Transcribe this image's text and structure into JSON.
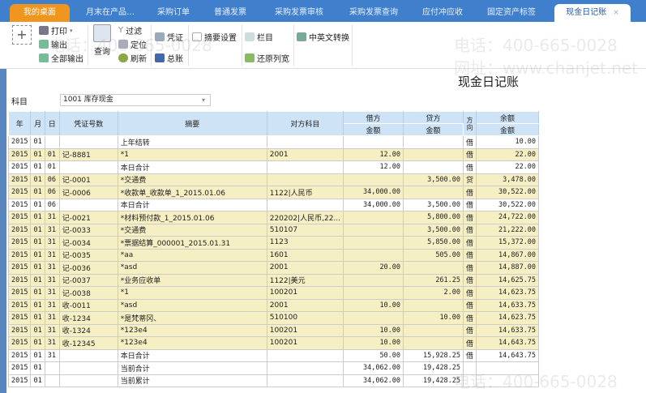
{
  "tabs": [
    {
      "label": "我的桌面"
    },
    {
      "label": "月末在产品…"
    },
    {
      "label": "采购订单"
    },
    {
      "label": "普通发票"
    },
    {
      "label": "采购发票审核"
    },
    {
      "label": "采购发票查询"
    },
    {
      "label": "应付冲应收"
    },
    {
      "label": "固定资产标签"
    },
    {
      "label": "现金日记账",
      "close": "×"
    }
  ],
  "toolbar": {
    "add": "+",
    "print": "打印",
    "output": "输出",
    "output_all": "全部输出",
    "query": "查询",
    "filter": "过滤",
    "locate": "定位",
    "refresh": "刷新",
    "voucher": "凭证",
    "ledger": "总账",
    "summary_setting": "摘要设置",
    "columns": "栏目",
    "restore_width": "还原列宽",
    "cn_en": "中英文转换"
  },
  "page": {
    "title": "现金日记账",
    "subject_label": "科目",
    "subject_value": "1001 库存现金"
  },
  "headers": {
    "year": "年",
    "month": "月",
    "day": "日",
    "voucher_no": "凭证号数",
    "summary": "摘要",
    "counter_account": "对方科目",
    "debit": "借方",
    "credit": "贷方",
    "amount": "金额",
    "direction": "方向",
    "balance": "余额"
  },
  "rows": [
    [
      "2015",
      "01",
      "",
      "",
      "上年结转",
      "",
      "",
      "",
      "借",
      "10.00",
      "w"
    ],
    [
      "2015",
      "01",
      "01",
      "记-8881",
      "*1",
      "2001",
      "12.00",
      "",
      "借",
      "22.00",
      "y"
    ],
    [
      "2015",
      "01",
      "01",
      "",
      "本日合计",
      "",
      "12.00",
      "",
      "借",
      "22.00",
      "w"
    ],
    [
      "2015",
      "01",
      "06",
      "记-0001",
      "*交通费",
      "",
      "",
      "3,500.00",
      "贷",
      "3,478.00",
      "y"
    ],
    [
      "2015",
      "01",
      "06",
      "记-0006",
      "*收款单_收款单_1_2015.01.06",
      "1122|人民币",
      "34,000.00",
      "",
      "借",
      "30,522.00",
      "y"
    ],
    [
      "2015",
      "01",
      "06",
      "",
      "本日合计",
      "",
      "34,000.00",
      "3,500.00",
      "借",
      "30,522.00",
      "w"
    ],
    [
      "2015",
      "01",
      "31",
      "记-0021",
      "*材料预付款_1_2015.01.06",
      "220202|人民币,22...",
      "",
      "5,800.00",
      "借",
      "24,722.00",
      "y"
    ],
    [
      "2015",
      "01",
      "31",
      "记-0033",
      "*交通费",
      "510107",
      "",
      "3,500.00",
      "借",
      "21,222.00",
      "y"
    ],
    [
      "2015",
      "01",
      "31",
      "记-0034",
      "*票据结算_000001_2015.01.31",
      "1123",
      "",
      "5,850.00",
      "借",
      "15,372.00",
      "y"
    ],
    [
      "2015",
      "01",
      "31",
      "记-0035",
      "*aa",
      "1601",
      "",
      "505.00",
      "借",
      "14,867.00",
      "y"
    ],
    [
      "2015",
      "01",
      "31",
      "记-0036",
      "*asd",
      "2001",
      "20.00",
      "",
      "借",
      "14,887.00",
      "y"
    ],
    [
      "2015",
      "01",
      "31",
      "记-0037",
      "*业务应收单",
      "1122|美元",
      "",
      "261.25",
      "借",
      "14,625.75",
      "y"
    ],
    [
      "2015",
      "01",
      "31",
      "记-0038",
      "*1",
      "100201",
      "",
      "2.00",
      "借",
      "14,623.75",
      "y"
    ],
    [
      "2015",
      "01",
      "31",
      "收-0011",
      "*asd",
      "2001",
      "10.00",
      "",
      "借",
      "14,633.75",
      "y"
    ],
    [
      "2015",
      "01",
      "31",
      "收-1234",
      "*是梵蒂冈、",
      "510100",
      "",
      "10.00",
      "借",
      "14,623.75",
      "y"
    ],
    [
      "2015",
      "01",
      "31",
      "收-1324",
      "*123e4",
      "100201",
      "10.00",
      "",
      "借",
      "14,633.75",
      "y"
    ],
    [
      "2015",
      "01",
      "31",
      "收-12345",
      "*123e4",
      "100201",
      "10.00",
      "",
      "借",
      "14,643.75",
      "y"
    ],
    [
      "2015",
      "01",
      "31",
      "",
      "本日合计",
      "",
      "50.00",
      "15,928.25",
      "借",
      "14,643.75",
      "w"
    ],
    [
      "2015",
      "01",
      "",
      "",
      "当前合计",
      "",
      "34,062.00",
      "19,428.25",
      "",
      "",
      "w"
    ],
    [
      "2015",
      "01",
      "",
      "",
      "当前累计",
      "",
      "34,062.00",
      "19,428.25",
      "",
      "",
      "w"
    ]
  ],
  "watermark": {
    "phone": "电话：400-665-0028",
    "site": "网址：www.chanjet.net"
  }
}
